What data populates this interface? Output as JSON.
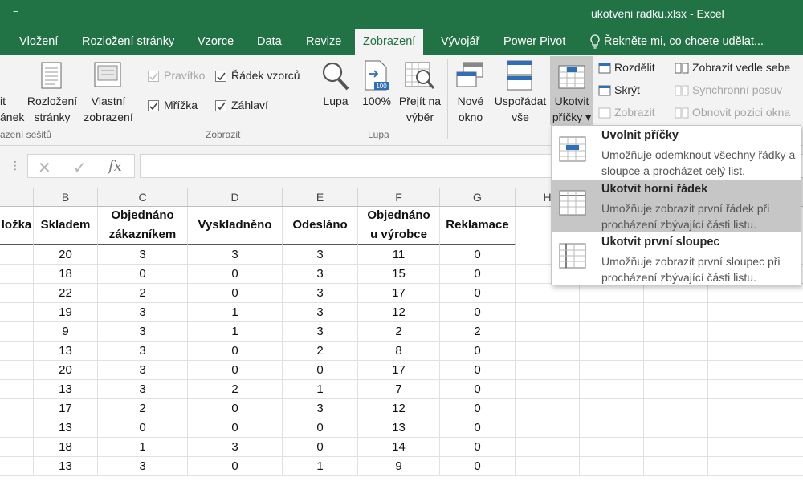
{
  "titlebar": {
    "quick_access": "=",
    "title": "ukotveni radku.xlsx  -  Excel"
  },
  "tabs": [
    {
      "label": "Vložení"
    },
    {
      "label": "Rozložení stránky"
    },
    {
      "label": "Vzorce"
    },
    {
      "label": "Data"
    },
    {
      "label": "Revize"
    },
    {
      "label": "Zobrazení"
    },
    {
      "label": "Vývojář"
    },
    {
      "label": "Power Pivot"
    },
    {
      "label": "Řekněte mi, co chcete udělat..."
    }
  ],
  "ribbon": {
    "views": {
      "it_label": "it",
      "anek_label": "ánek",
      "layout_line1": "Rozložení",
      "layout_line2": "stránky",
      "custom_line1": "Vlastní",
      "custom_line2": "zobrazení",
      "group": "azení sešitů"
    },
    "show": {
      "ruler": "Pravítko",
      "formula_bar": "Řádek vzorců",
      "gridlines": "Mřížka",
      "headings": "Záhlaví",
      "group": "Zobrazit"
    },
    "zoom": {
      "zoom": "Lupa",
      "hundred": "100%",
      "selection_line1": "Přejít na",
      "selection_line2": "výběr",
      "hundred_icon_text": "100",
      "group": "Lupa"
    },
    "window": {
      "new_line1": "Nové",
      "new_line2": "okno",
      "arrange_line1": "Uspořádat",
      "arrange_line2": "vše",
      "freeze_line1": "Ukotvit",
      "freeze_line2": "příčky ▾",
      "split": "Rozdělit",
      "hide": "Skrýt",
      "unhide": "Zobrazit",
      "side_by_side": "Zobrazit vedle sebe",
      "sync_scroll": "Synchronní posuv",
      "reset_pos": "Obnovit pozici okna"
    }
  },
  "formula_bar": {
    "name_box_grip": "⋮",
    "cancel": "✕",
    "enter": "✓",
    "fx": "fx",
    "value": ""
  },
  "columns": [
    "B",
    "C",
    "D",
    "E",
    "F",
    "G",
    "H"
  ],
  "table": {
    "headers": [
      {
        "line1": "ložka",
        "line2": ""
      },
      {
        "line1": "Skladem",
        "line2": ""
      },
      {
        "line1": "Objednáno",
        "line2": "zákazníkem"
      },
      {
        "line1": "Vyskladněno",
        "line2": ""
      },
      {
        "line1": "Odesláno",
        "line2": ""
      },
      {
        "line1": "Objednáno",
        "line2": "u výrobce"
      },
      {
        "line1": "Reklamace",
        "line2": ""
      }
    ],
    "rows": [
      [
        "20",
        "3",
        "3",
        "3",
        "11",
        "0"
      ],
      [
        "18",
        "0",
        "0",
        "3",
        "15",
        "0"
      ],
      [
        "22",
        "2",
        "0",
        "3",
        "17",
        "0"
      ],
      [
        "19",
        "3",
        "1",
        "3",
        "12",
        "0"
      ],
      [
        "9",
        "3",
        "1",
        "3",
        "2",
        "2"
      ],
      [
        "13",
        "3",
        "0",
        "2",
        "8",
        "0"
      ],
      [
        "20",
        "3",
        "0",
        "0",
        "17",
        "0"
      ],
      [
        "13",
        "3",
        "2",
        "1",
        "7",
        "0"
      ],
      [
        "17",
        "2",
        "0",
        "3",
        "12",
        "0"
      ],
      [
        "13",
        "0",
        "0",
        "0",
        "13",
        "0"
      ],
      [
        "18",
        "1",
        "3",
        "0",
        "14",
        "0"
      ],
      [
        "13",
        "3",
        "0",
        "1",
        "9",
        "0"
      ]
    ]
  },
  "freeze_menu": {
    "items": [
      {
        "title": "Uvolnit příčky",
        "desc": "Umožňuje odemknout všechny řádky a sloupce a procházet celý list."
      },
      {
        "title": "Ukotvit horní řádek",
        "desc": "Umožňuje zobrazit první řádek při procházení zbývající části listu."
      },
      {
        "title": "Ukotvit první sloupec",
        "desc": "Umožňuje zobrazit první sloupec při procházení zbývající části listu."
      }
    ]
  },
  "colors": {
    "excel_green": "#217346",
    "ribbon_bg": "#f3f3f3",
    "hover": "#c6c6c6"
  }
}
